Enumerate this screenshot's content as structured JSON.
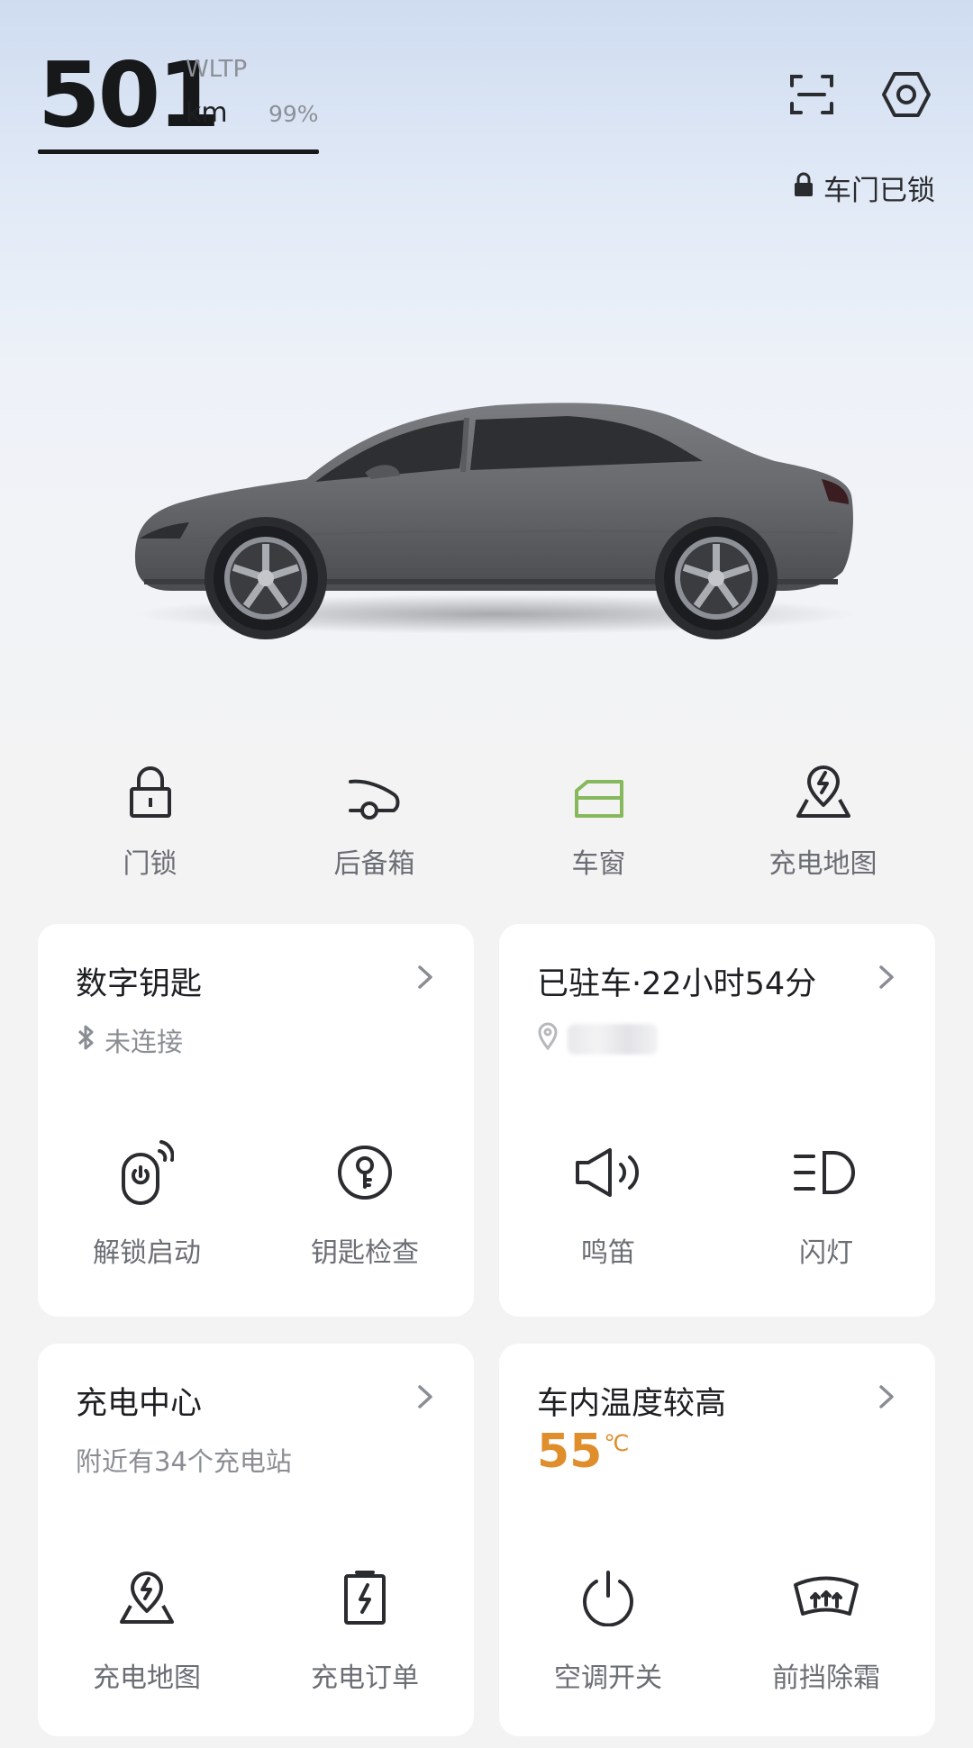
{
  "header": {
    "range_value": "501",
    "range_standard": "WLTP",
    "range_unit": "km",
    "battery_percent": "99%",
    "lock_status": "车门已锁",
    "icons": [
      "scan-icon",
      "settings-hex-icon"
    ]
  },
  "quick_actions": [
    {
      "label": "门锁",
      "icon": "lock-icon"
    },
    {
      "label": "后备箱",
      "icon": "trunk-icon"
    },
    {
      "label": "车窗",
      "icon": "window-icon",
      "active": true
    },
    {
      "label": "充电地图",
      "icon": "charge-map-icon"
    }
  ],
  "cards": {
    "digital_key": {
      "title": "数字钥匙",
      "status": "未连接",
      "actions": [
        {
          "label": "解锁启动",
          "icon": "unlock-start-icon"
        },
        {
          "label": "钥匙检查",
          "icon": "key-check-icon"
        }
      ]
    },
    "parking": {
      "title": "已驻车·22小时54分",
      "actions": [
        {
          "label": "鸣笛",
          "icon": "horn-icon"
        },
        {
          "label": "闪灯",
          "icon": "flash-light-icon"
        }
      ]
    },
    "charging": {
      "title": "充电中心",
      "subtitle": "附近有34个充电站",
      "actions": [
        {
          "label": "充电地图",
          "icon": "charge-map-icon"
        },
        {
          "label": "充电订单",
          "icon": "charge-order-icon"
        }
      ]
    },
    "climate": {
      "title": "车内温度较高",
      "temperature": "55",
      "temperature_unit": "℃",
      "actions": [
        {
          "label": "空调开关",
          "icon": "power-icon"
        },
        {
          "label": "前挡除霜",
          "icon": "defrost-icon"
        }
      ]
    }
  },
  "colors": {
    "accent_green": "#86b85c",
    "temperature_orange": "#e08d2b",
    "text_primary": "#1e1f22",
    "text_secondary": "#6b6e74"
  }
}
